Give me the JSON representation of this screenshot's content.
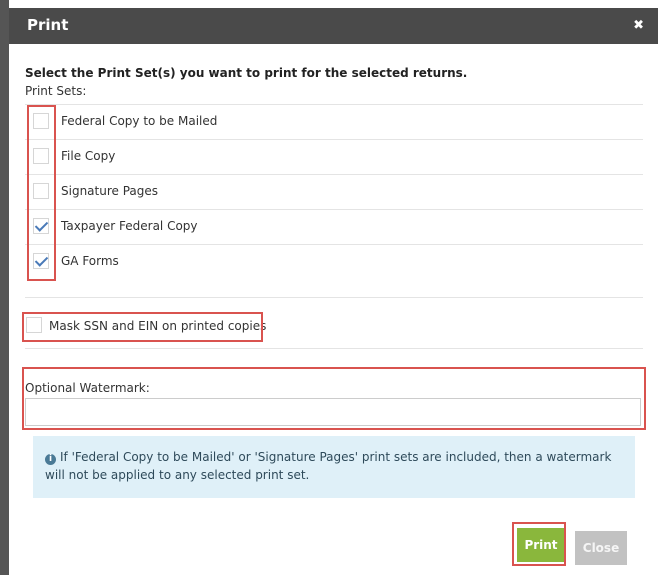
{
  "dialog": {
    "title": "Print",
    "close_icon": "✖"
  },
  "instruction": "Select the Print Set(s) you want to print for the selected returns.",
  "print_sets_label": "Print Sets:",
  "print_sets": [
    {
      "label": "Federal Copy to be Mailed",
      "checked": false
    },
    {
      "label": "File Copy",
      "checked": false
    },
    {
      "label": "Signature Pages",
      "checked": false
    },
    {
      "label": "Taxpayer Federal Copy",
      "checked": true
    },
    {
      "label": "GA Forms",
      "checked": true
    }
  ],
  "mask": {
    "label": "Mask SSN and EIN on printed copies",
    "checked": false
  },
  "watermark": {
    "label": "Optional Watermark:",
    "value": "",
    "placeholder": ""
  },
  "info_message": "If 'Federal Copy to be Mailed' or 'Signature Pages' print sets are included, then a watermark will not be applied to any selected print set.",
  "buttons": {
    "print": "Print",
    "close": "Close"
  },
  "colors": {
    "title_bar": "#4a4a4a",
    "highlight": "#d9534f",
    "print_button": "#8ab73c",
    "close_button": "#c2c2c2",
    "info_bg": "#dff0f8",
    "check": "#4a7ab8"
  }
}
